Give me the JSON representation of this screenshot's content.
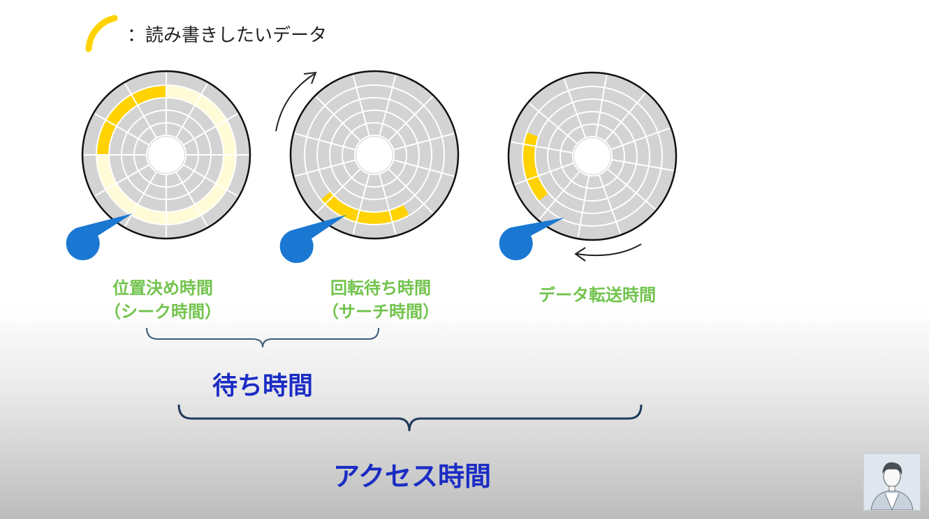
{
  "legend": {
    "text": "：読み書きしたいデータ",
    "swatch_color": "#ffd200"
  },
  "disks": [
    {
      "label_line1": "位置決め時間",
      "label_line2": "（シーク時間）"
    },
    {
      "label_line1": "回転待ち時間",
      "label_line2": "（サーチ時間）"
    },
    {
      "label_line1": "データ転送時間",
      "label_line2": ""
    }
  ],
  "groups": {
    "wait_time": "待ち時間",
    "access_time": "アクセス時間"
  },
  "colors": {
    "platter": "#d3d3d3",
    "data_highlight": "#ffd200",
    "seek_track": "#fffbd6",
    "head": "#1a78d2",
    "label_green": "#71c34c",
    "label_blue": "#1b2cc4",
    "bracket": "#3a5a7a"
  },
  "icons": {
    "rotate_cw": "curved-arrow-clockwise-icon",
    "rotate_ccw": "curved-arrow-counterclockwise-icon",
    "presenter": "presenter-avatar-icon"
  }
}
